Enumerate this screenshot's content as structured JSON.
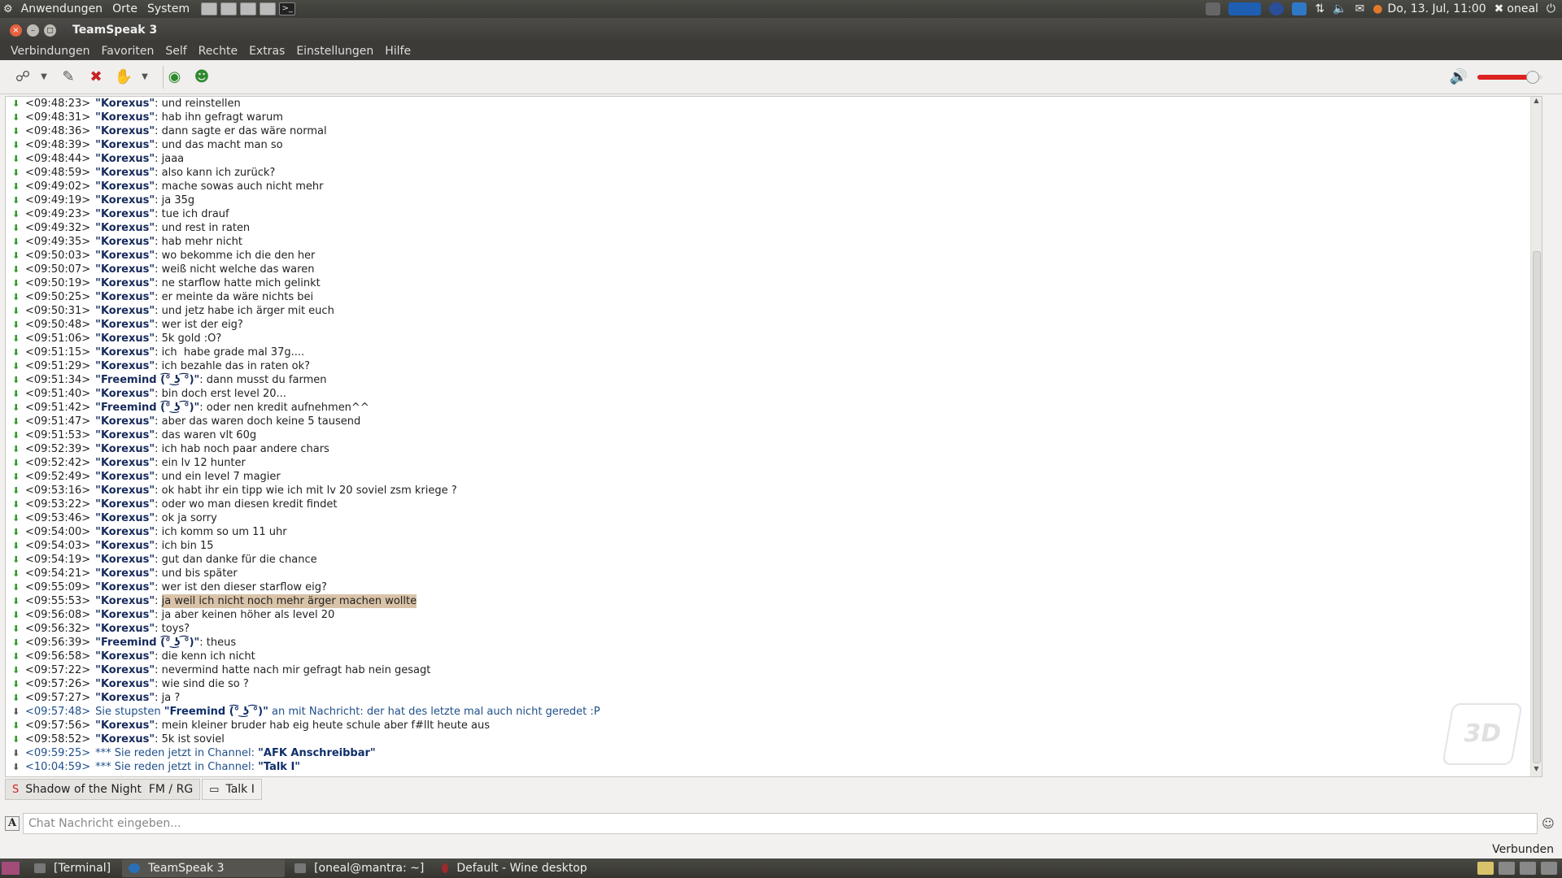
{
  "top_panel": {
    "menus": [
      "Anwendungen",
      "Orte",
      "System"
    ],
    "datetime": "Do, 13. Jul, 11:00",
    "user": "oneal"
  },
  "window": {
    "title": "TeamSpeak 3"
  },
  "menubar": [
    "Verbindungen",
    "Favoriten",
    "Self",
    "Rechte",
    "Extras",
    "Einstellungen",
    "Hilfe"
  ],
  "chat": {
    "lines": [
      {
        "ts": "<09:48:23>",
        "nick": "\"Korexus\"",
        "sep": ": ",
        "msg": "und reinstellen",
        "type": "msg"
      },
      {
        "ts": "<09:48:31>",
        "nick": "\"Korexus\"",
        "sep": ": ",
        "msg": "hab ihn gefragt warum",
        "type": "msg"
      },
      {
        "ts": "<09:48:36>",
        "nick": "\"Korexus\"",
        "sep": ": ",
        "msg": "dann sagte er das wäre normal",
        "type": "msg"
      },
      {
        "ts": "<09:48:39>",
        "nick": "\"Korexus\"",
        "sep": ": ",
        "msg": "und das macht man so",
        "type": "msg"
      },
      {
        "ts": "<09:48:44>",
        "nick": "\"Korexus\"",
        "sep": ": ",
        "msg": "jaaa",
        "type": "msg"
      },
      {
        "ts": "<09:48:59>",
        "nick": "\"Korexus\"",
        "sep": ": ",
        "msg": "also kann ich zurück?",
        "type": "msg"
      },
      {
        "ts": "<09:49:02>",
        "nick": "\"Korexus\"",
        "sep": ": ",
        "msg": "mache sowas auch nicht mehr",
        "type": "msg"
      },
      {
        "ts": "<09:49:19>",
        "nick": "\"Korexus\"",
        "sep": ": ",
        "msg": "ja 35g",
        "type": "msg"
      },
      {
        "ts": "<09:49:23>",
        "nick": "\"Korexus\"",
        "sep": ": ",
        "msg": "tue ich drauf",
        "type": "msg"
      },
      {
        "ts": "<09:49:32>",
        "nick": "\"Korexus\"",
        "sep": ": ",
        "msg": "und rest in raten",
        "type": "msg"
      },
      {
        "ts": "<09:49:35>",
        "nick": "\"Korexus\"",
        "sep": ": ",
        "msg": "hab mehr nicht",
        "type": "msg"
      },
      {
        "ts": "<09:50:03>",
        "nick": "\"Korexus\"",
        "sep": ": ",
        "msg": "wo bekomme ich die den her",
        "type": "msg"
      },
      {
        "ts": "<09:50:07>",
        "nick": "\"Korexus\"",
        "sep": ": ",
        "msg": "weiß nicht welche das waren",
        "type": "msg"
      },
      {
        "ts": "<09:50:19>",
        "nick": "\"Korexus\"",
        "sep": ": ",
        "msg": "ne starflow hatte mich gelinkt",
        "type": "msg"
      },
      {
        "ts": "<09:50:25>",
        "nick": "\"Korexus\"",
        "sep": ": ",
        "msg": "er meinte da wäre nichts bei",
        "type": "msg"
      },
      {
        "ts": "<09:50:31>",
        "nick": "\"Korexus\"",
        "sep": ": ",
        "msg": "und jetz habe ich ärger mit euch",
        "type": "msg"
      },
      {
        "ts": "<09:50:48>",
        "nick": "\"Korexus\"",
        "sep": ": ",
        "msg": "wer ist der eig?",
        "type": "msg"
      },
      {
        "ts": "<09:51:06>",
        "nick": "\"Korexus\"",
        "sep": ": ",
        "msg": "5k gold :O?",
        "type": "msg"
      },
      {
        "ts": "<09:51:15>",
        "nick": "\"Korexus\"",
        "sep": ": ",
        "msg": "ich  habe grade mal 37g....",
        "type": "msg"
      },
      {
        "ts": "<09:51:29>",
        "nick": "\"Korexus\"",
        "sep": ": ",
        "msg": "ich bezahle das in raten ok?",
        "type": "msg"
      },
      {
        "ts": "<09:51:34>",
        "nick": "\"Freemind (͡° ͜ʖ ͡°)\"",
        "sep": ": ",
        "msg": "dann musst du farmen",
        "type": "msg"
      },
      {
        "ts": "<09:51:40>",
        "nick": "\"Korexus\"",
        "sep": ": ",
        "msg": "bin doch erst level 20...",
        "type": "msg"
      },
      {
        "ts": "<09:51:42>",
        "nick": "\"Freemind (͡° ͜ʖ ͡°)\"",
        "sep": ": ",
        "msg": "oder nen kredit aufnehmen^^",
        "type": "msg"
      },
      {
        "ts": "<09:51:47>",
        "nick": "\"Korexus\"",
        "sep": ": ",
        "msg": "aber das waren doch keine 5 tausend",
        "type": "msg"
      },
      {
        "ts": "<09:51:53>",
        "nick": "\"Korexus\"",
        "sep": ": ",
        "msg": "das waren vlt 60g",
        "type": "msg"
      },
      {
        "ts": "<09:52:39>",
        "nick": "\"Korexus\"",
        "sep": ": ",
        "msg": "ich hab noch paar andere chars",
        "type": "msg"
      },
      {
        "ts": "<09:52:42>",
        "nick": "\"Korexus\"",
        "sep": ": ",
        "msg": "ein lv 12 hunter",
        "type": "msg"
      },
      {
        "ts": "<09:52:49>",
        "nick": "\"Korexus\"",
        "sep": ": ",
        "msg": "und ein level 7 magier",
        "type": "msg"
      },
      {
        "ts": "<09:53:16>",
        "nick": "\"Korexus\"",
        "sep": ": ",
        "msg": "ok habt ihr ein tipp wie ich mit lv 20 soviel zsm kriege ?",
        "type": "msg"
      },
      {
        "ts": "<09:53:22>",
        "nick": "\"Korexus\"",
        "sep": ": ",
        "msg": "oder wo man diesen kredit findet",
        "type": "msg"
      },
      {
        "ts": "<09:53:46>",
        "nick": "\"Korexus\"",
        "sep": ": ",
        "msg": "ok ja sorry",
        "type": "msg"
      },
      {
        "ts": "<09:54:00>",
        "nick": "\"Korexus\"",
        "sep": ": ",
        "msg": "ich komm so um 11 uhr",
        "type": "msg"
      },
      {
        "ts": "<09:54:03>",
        "nick": "\"Korexus\"",
        "sep": ": ",
        "msg": "ich bin 15",
        "type": "msg"
      },
      {
        "ts": "<09:54:19>",
        "nick": "\"Korexus\"",
        "sep": ": ",
        "msg": "gut dan danke für die chance",
        "type": "msg"
      },
      {
        "ts": "<09:54:21>",
        "nick": "\"Korexus\"",
        "sep": ": ",
        "msg": "und bis später",
        "type": "msg"
      },
      {
        "ts": "<09:55:09>",
        "nick": "\"Korexus\"",
        "sep": ": ",
        "msg": "wer ist den dieser starflow eig?",
        "type": "msg"
      },
      {
        "ts": "<09:55:53>",
        "nick": "\"Korexus\"",
        "sep": ": ",
        "msg": "ja weil ich nicht noch mehr ärger machen wollte",
        "type": "hl"
      },
      {
        "ts": "<09:56:08>",
        "nick": "\"Korexus\"",
        "sep": ": ",
        "msg": "ja aber keinen höher als level 20",
        "type": "msg"
      },
      {
        "ts": "<09:56:32>",
        "nick": "\"Korexus\"",
        "sep": ": ",
        "msg": "toys?",
        "type": "msg"
      },
      {
        "ts": "<09:56:39>",
        "nick": "\"Freemind (͡° ͜ʖ ͡°)\"",
        "sep": ": ",
        "msg": "theus",
        "type": "msg"
      },
      {
        "ts": "<09:56:58>",
        "nick": "\"Korexus\"",
        "sep": ": ",
        "msg": "die kenn ich nicht",
        "type": "msg"
      },
      {
        "ts": "<09:57:22>",
        "nick": "\"Korexus\"",
        "sep": ": ",
        "msg": "nevermind hatte nach mir gefragt hab nein gesagt",
        "type": "msg"
      },
      {
        "ts": "<09:57:26>",
        "nick": "\"Korexus\"",
        "sep": ": ",
        "msg": "wie sind die so ?",
        "type": "msg"
      },
      {
        "ts": "<09:57:27>",
        "nick": "\"Korexus\"",
        "sep": ": ",
        "msg": "ja ?",
        "type": "msg"
      },
      {
        "ts": "<09:57:48>",
        "pre": "Sie stupsten ",
        "nick": "\"Freemind (͡° ͜ʖ ͡°)\"",
        "sep": " ",
        "msg": "an mit Nachricht: der hat des letzte mal auch nicht geredet :P",
        "type": "sys"
      },
      {
        "ts": "<09:57:56>",
        "nick": "\"Korexus\"",
        "sep": ": ",
        "msg": "mein kleiner bruder hab eig heute schule aber f#llt heute aus",
        "type": "msg"
      },
      {
        "ts": "<09:58:52>",
        "nick": "\"Korexus\"",
        "sep": ": ",
        "msg": "5k ist soviel",
        "type": "msg"
      },
      {
        "ts": "<09:59:25>",
        "pre": "*** Sie reden jetzt in Channel: ",
        "nick": "\"AFK Anschreibbar\"",
        "sep": "",
        "msg": "",
        "type": "sys"
      },
      {
        "ts": "<10:04:59>",
        "pre": "*** Sie reden jetzt in Channel: ",
        "nick": "\"Talk I\"",
        "sep": "",
        "msg": "",
        "type": "sys"
      }
    ]
  },
  "tabs": [
    {
      "label": "Shadow of the Night  FM / RG",
      "icon": "server-icon"
    },
    {
      "label": "Talk I",
      "icon": "channel-chat-icon"
    }
  ],
  "input": {
    "placeholder": "Chat Nachricht eingeben..."
  },
  "status": "Verbunden",
  "taskbar": [
    {
      "label": "[Terminal]",
      "icon": "terminal-icon"
    },
    {
      "label": "TeamSpeak 3",
      "icon": "teamspeak-icon",
      "active": true
    },
    {
      "label": "[oneal@mantra: ~]",
      "icon": "terminal-icon"
    },
    {
      "label": "Default - Wine desktop",
      "icon": "wine-icon"
    }
  ],
  "volume_level": 0.85
}
